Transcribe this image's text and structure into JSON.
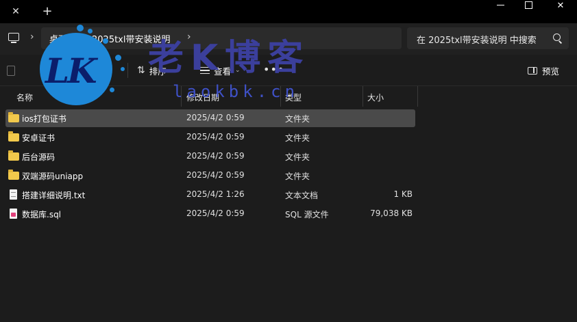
{
  "titlebar": {
    "tab_close": "✕",
    "tab_add": "+",
    "min": "",
    "max": "",
    "close": "✕"
  },
  "address": {
    "crumbs": [
      "桌面",
      "2025txl带安装说明"
    ],
    "chevron": "›",
    "search_placeholder": "在 2025txl带安装说明 中搜索"
  },
  "commandbar": {
    "sort_label": "排序",
    "view_label": "查看",
    "more_label": "•••",
    "preview_label": "预览",
    "dropdown_chevron": "⌄"
  },
  "columns": [
    "名称",
    "修改日期",
    "类型",
    "大小"
  ],
  "files": [
    {
      "name": "ios打包证书",
      "date": "2025/4/2 0:59",
      "type": "文件夹",
      "size": "",
      "icon": "folder-icon",
      "selected": true
    },
    {
      "name": "安卓证书",
      "date": "2025/4/2 0:59",
      "type": "文件夹",
      "size": "",
      "icon": "folder-icon",
      "selected": false
    },
    {
      "name": "后台源码",
      "date": "2025/4/2 0:59",
      "type": "文件夹",
      "size": "",
      "icon": "folder-icon",
      "selected": false
    },
    {
      "name": "双端源码uniapp",
      "date": "2025/4/2 0:59",
      "type": "文件夹",
      "size": "",
      "icon": "folder-icon",
      "selected": false
    },
    {
      "name": "搭建详细说明.txt",
      "date": "2025/4/2 1:26",
      "type": "文本文档",
      "size": "1 KB",
      "icon": "text-file-icon",
      "selected": false
    },
    {
      "name": "数据库.sql",
      "date": "2025/4/2 0:59",
      "type": "SQL 源文件",
      "size": "79,038 KB",
      "icon": "sql-file-icon",
      "selected": false
    }
  ],
  "watermark": {
    "logo_text": "LK",
    "title": "老K博客",
    "url": "laokbk.cn"
  },
  "colors": {
    "background": "#1c1c1c",
    "titlebar": "#000000",
    "selected_row": "#4a4a4a",
    "folder": "#f2c94c",
    "watermark_blue": "#1e88d8",
    "watermark_title": "#3b3f9c"
  }
}
